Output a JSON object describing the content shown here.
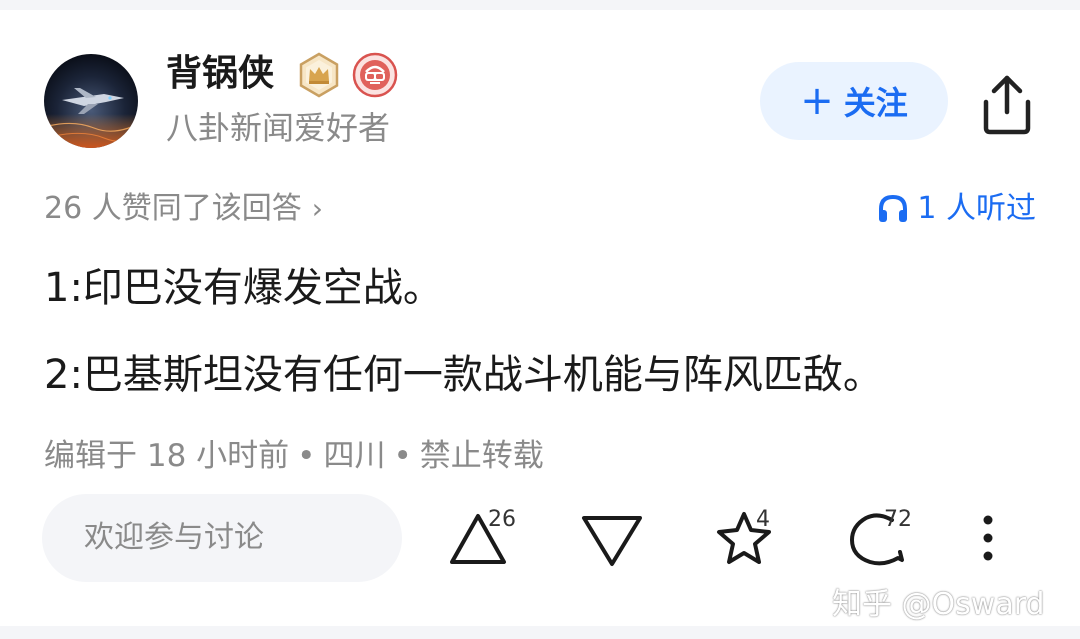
{
  "author": {
    "name": "背锅侠",
    "bio": "八卦新闻爱好者"
  },
  "follow_button": {
    "icon": "+",
    "label": "关注"
  },
  "stats": {
    "votes_text": "26 人赞同了该回答",
    "listened_text": "1 人听过"
  },
  "answer": {
    "paragraphs": [
      "1:印巴没有爆发空战。",
      "2:巴基斯坦没有任何一款战斗机能与阵风匹敌。"
    ]
  },
  "meta": {
    "edited": "编辑于 18 小时前",
    "location": "四川",
    "copyright": "禁止转载",
    "separator": "•"
  },
  "actions": {
    "comment_placeholder": "欢迎参与讨论",
    "upvote_count": "26",
    "favorite_count": "4",
    "comment_count": "72"
  },
  "watermark": "知乎 @Osward",
  "colors": {
    "accent": "#1b6cf2",
    "follow_bg": "#eaf3ff",
    "secondary_text": "#8a8a8a",
    "primary_text": "#1a1a1a"
  },
  "icons": {
    "crown_badge": "crown-badge-icon",
    "vr_badge": "vr-headset-badge-icon",
    "share": "share-icon",
    "headphones": "headphones-icon",
    "upvote": "triangle-up-icon",
    "downvote": "triangle-down-icon",
    "favorite": "star-icon",
    "comment": "comment-bubble-icon",
    "more": "more-vertical-icon"
  }
}
